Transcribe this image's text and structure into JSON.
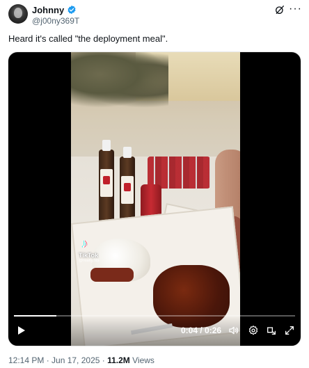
{
  "post": {
    "display_name": "Johnny",
    "handle": "@j00ny369T",
    "text": "Heard it's called \"the deployment meal\".",
    "date": "12:14 PM · Jun 17, 2025 · ",
    "views_count": "11.2M",
    "views_label": " Views"
  },
  "video": {
    "watermark_brand": "TikTok",
    "watermark_user": "@realty.fits",
    "time": "0:04 / 0:26",
    "progress": 0.15
  },
  "icons": {
    "verified": "verified-badge-icon",
    "grok": "grok-icon",
    "more": "more-icon",
    "play": "play-icon",
    "volume": "volume-icon",
    "settings": "settings-icon",
    "dock": "dock-icon",
    "fullscreen": "fullscreen-icon"
  },
  "colors": {
    "verified_blue": "#1d9bf0",
    "muted_text": "#536471"
  }
}
